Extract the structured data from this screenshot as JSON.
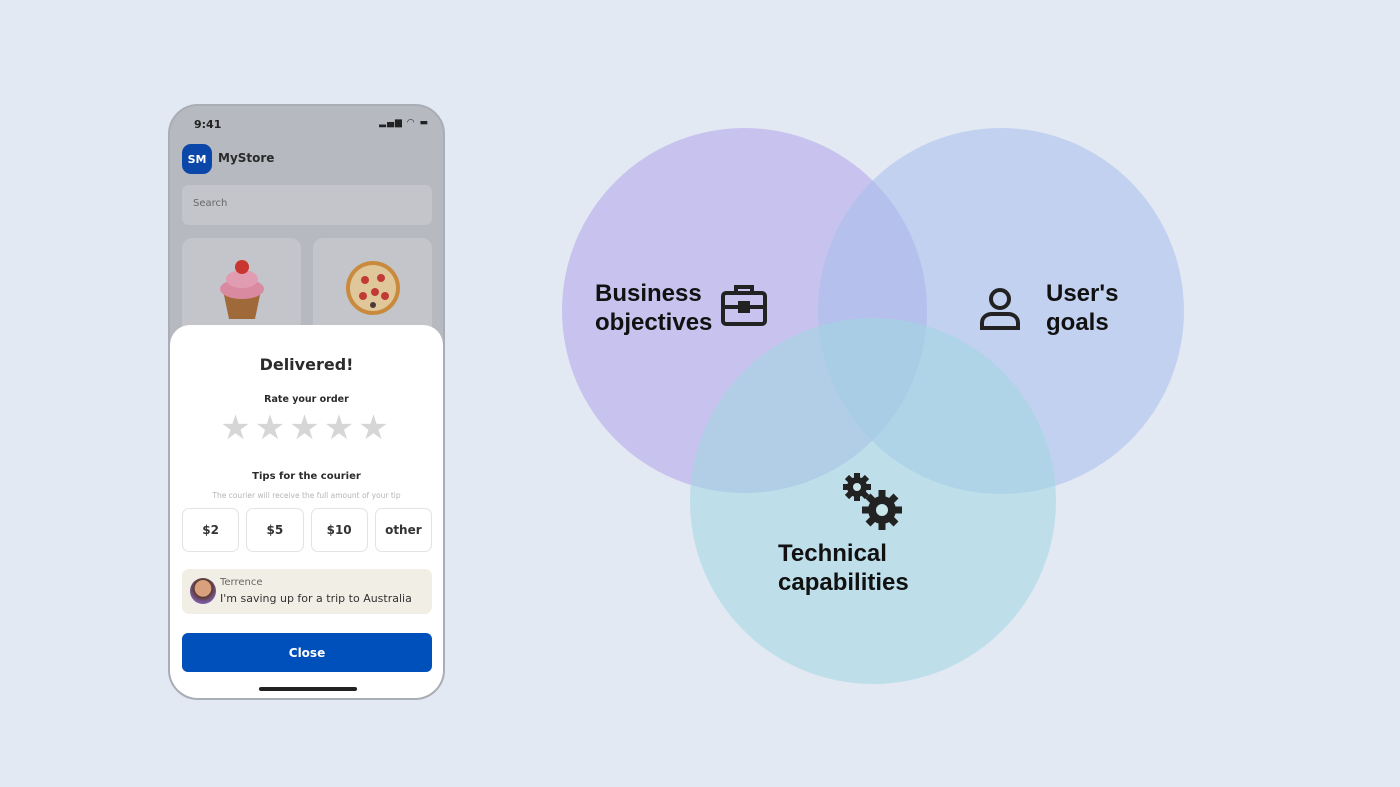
{
  "phone": {
    "time": "9:41",
    "app": {
      "logo": "SM",
      "name": "MyStore"
    },
    "search": {
      "placeholder": "Search"
    },
    "products": [
      {
        "icon": "cupcake-icon"
      },
      {
        "icon": "pizza-icon"
      }
    ],
    "sheet": {
      "title": "Delivered!",
      "rate_label": "Rate your order",
      "rating": 0,
      "tips_title": "Tips for the courier",
      "tips_note": "The courier will receive the full amount of your tip",
      "tips": [
        "$2",
        "$5",
        "$10",
        "other"
      ],
      "courier": {
        "name": "Terrence",
        "message": "I'm saving up for a trip to Australia"
      },
      "close_label": "Close"
    }
  },
  "venn": {
    "business": {
      "line1": "Business",
      "line2": "objectives",
      "icon": "briefcase-icon",
      "color": "#c9c8ee"
    },
    "user": {
      "line1": "User's",
      "line2": "goals",
      "icon": "user-icon",
      "color": "#c3d4ee"
    },
    "tech": {
      "line1": "Technical",
      "line2": "capabilities",
      "icon": "gears-icon",
      "color": "#c1e3e8"
    }
  }
}
